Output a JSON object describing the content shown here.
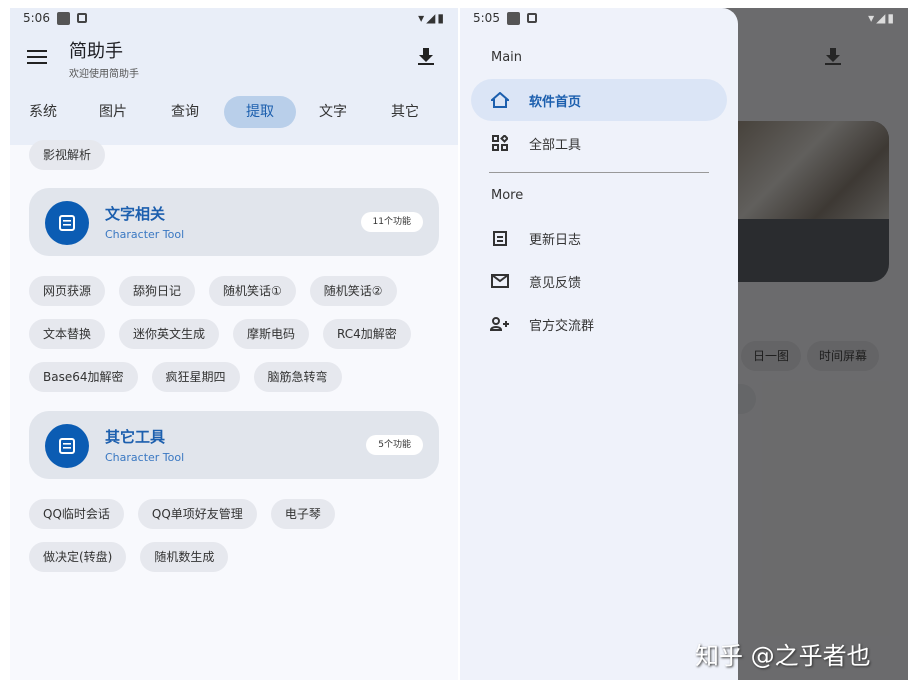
{
  "left": {
    "status": {
      "time": "5:06",
      "icons": "▾◢▮"
    },
    "header": {
      "title": "简助手",
      "subtitle": "欢迎使用简助手",
      "menu_icon": "menu-icon",
      "download_icon": "download-icon"
    },
    "tabs": [
      {
        "label": "系统"
      },
      {
        "label": "图片"
      },
      {
        "label": "查询"
      },
      {
        "label": "提取",
        "active": true
      },
      {
        "label": "文字"
      },
      {
        "label": "其它"
      }
    ],
    "top_chip": "影视解析",
    "sections": [
      {
        "title": "文字相关",
        "subtitle": "Character Tool",
        "badge": "11个功能",
        "rows": [
          [
            "网页获源",
            "舔狗日记",
            "随机笑话①",
            "随机笑话②"
          ],
          [
            "文本替换",
            "迷你英文生成",
            "摩斯电码",
            "RC4加解密"
          ],
          [
            "Base64加解密",
            "疯狂星期四",
            "脑筋急转弯"
          ]
        ]
      },
      {
        "title": "其它工具",
        "subtitle": "Character Tool",
        "badge": "5个功能",
        "rows": [
          [
            "QQ临时会话",
            "QQ单项好友管理",
            "电子琴"
          ],
          [
            "做决定(转盘)",
            "随机数生成"
          ]
        ]
      }
    ]
  },
  "right": {
    "status": {
      "time": "5:05",
      "icons": "▾◢▮"
    },
    "background_chips": [
      "日一图",
      "时间屏幕",
      ""
    ],
    "drawer": {
      "main_label": "Main",
      "main_items": [
        {
          "label": "软件首页",
          "icon": "home-icon",
          "active": true
        },
        {
          "label": "全部工具",
          "icon": "grid-icon"
        }
      ],
      "more_label": "More",
      "more_items": [
        {
          "label": "更新日志",
          "icon": "clipboard-icon"
        },
        {
          "label": "意见反馈",
          "icon": "mail-icon"
        },
        {
          "label": "官方交流群",
          "icon": "group-add-icon"
        }
      ]
    }
  },
  "watermark": "知乎 @之乎者也",
  "colors": {
    "accent": "#1c5fae",
    "active_tab": "#b9cfea",
    "card_icon": "#0b5cb3",
    "header_bg": "#e9eef8"
  }
}
